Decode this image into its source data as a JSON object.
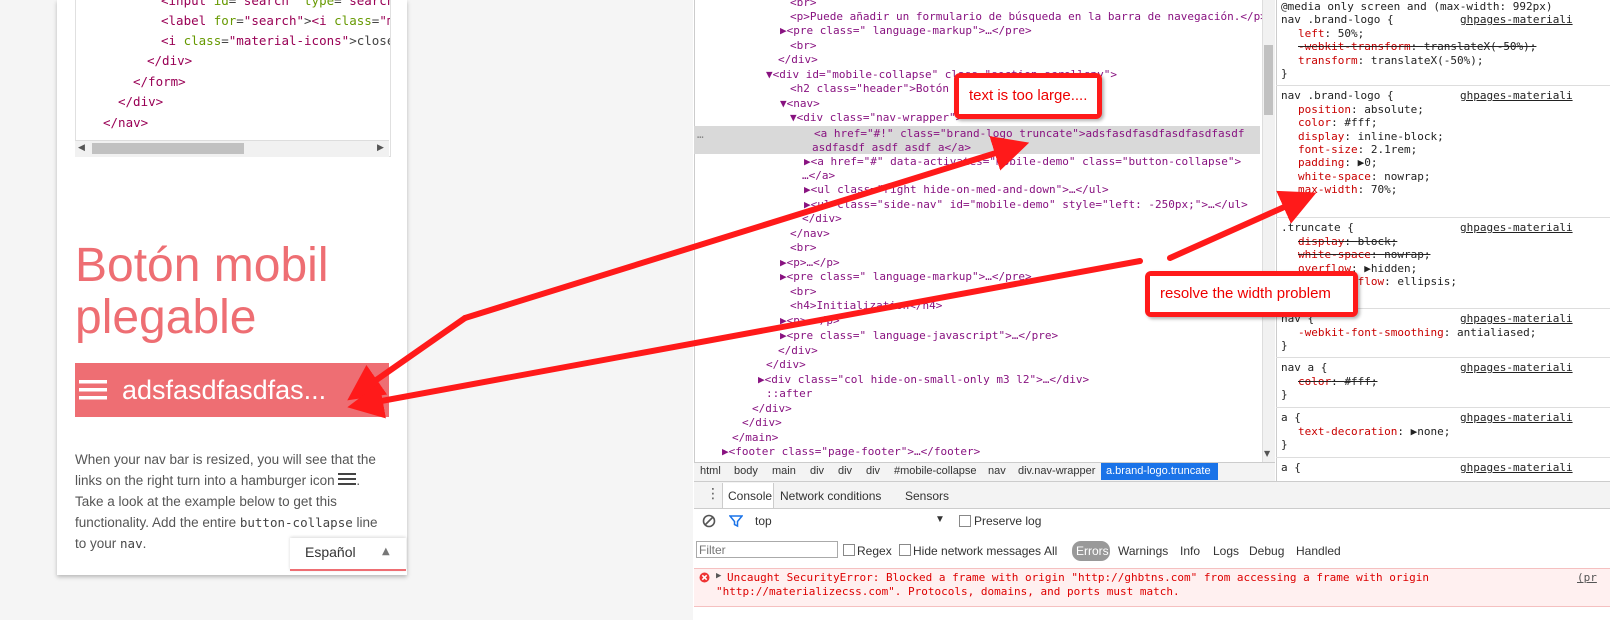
{
  "left_page": {
    "code_lines": [
      {
        "tag_open": "<input id=\"search\" type=\"search\"",
        "indent": 3
      },
      {
        "text": "<label for=\"search\"><i class=\"m",
        "indent": 3
      },
      {
        "text": "<i class=\"material-icons\">close</",
        "indent": 3
      },
      {
        "text": "</div>",
        "indent": 2
      },
      {
        "text": "</form>",
        "indent": 1
      },
      {
        "text": "</div>",
        "indent": 0
      },
      {
        "text": "</nav>",
        "indent": -1
      }
    ],
    "heading": "Botón mobil plegable",
    "brand_logo_text": "adsfasdfasdfas...",
    "paragraph_parts": {
      "p1": "When your nav bar is resized, you will see that the links on the right turn into a hamburger icon ",
      "p2": ". Take a look at the example below to get this functionality. Add the entire ",
      "code1": "button-collapse",
      "p3": " line to your ",
      "code2": "nav",
      "p4": "."
    },
    "language_selector": "Español"
  },
  "elements_panel": {
    "lines": [
      "<br>",
      "<p>Puede añadir un formulario de búsqueda en la barra de navegación.</p>",
      "▶<pre class=\" language-markup\">…</pre>",
      "<br>",
      "</div>",
      "▼<div id=\"mobile-collapse\" class=\"section scrollspy\">",
      "<h2 class=\"header\">Botón mobil plegable</h2>",
      "▼<nav>",
      "▼<div class=\"nav-wrapper\">",
      "<a href=\"#!\" class=\"brand-logo truncate\">adsfasdfasdfasdfasdfasdf",
      "asdfasdf asdf asdf a</a>",
      "▶<a href=\"#\" data-activates=\"mobile-demo\" class=\"button-collapse\">",
      "…</a>",
      "▶<ul class=\"right hide-on-med-and-down\">…</ul>",
      "▶<ul class=\"side-nav\" id=\"mobile-demo\" style=\"left: -250px;\">…</ul>",
      "</div>",
      "</nav>",
      "<br>",
      "▶<p>…</p>",
      "▶<pre class=\" language-markup\">…</pre>",
      "<br>",
      "<h4>Initialization</h4>",
      "▶<p>…</p>",
      "▶<pre class=\" language-javascript\">…</pre>",
      "</div>",
      "</div>",
      "▶<div class=\"col hide-on-small-only m3 l2\">…</div>",
      "::after",
      "</div>",
      "</div>",
      "</main>",
      "▶<footer class=\"page-footer\">…</footer>"
    ],
    "breadcrumb": [
      "html",
      "body",
      "main",
      "div",
      "div",
      "div",
      "#mobile-collapse",
      "nav",
      "div.nav-wrapper",
      "a.brand-logo.truncate"
    ]
  },
  "styles_panel": {
    "media_query": "@media only screen and (max-width: 992px)",
    "source": "ghpages-materiali",
    "rules": [
      {
        "selector": "nav .brand-logo {",
        "props": [
          {
            "name": "left",
            "value": "50%;",
            "struck": false
          },
          {
            "name": "-webkit-transform",
            "value": "translateX(-50%);",
            "struck": true
          },
          {
            "name": "transform",
            "value": "translateX(-50%);",
            "struck": false
          }
        ]
      },
      {
        "selector": "nav .brand-logo {",
        "props": [
          {
            "name": "position",
            "value": "absolute;",
            "struck": false
          },
          {
            "name": "color",
            "value": "#fff;",
            "struck": false
          },
          {
            "name": "display",
            "value": "inline-block;",
            "struck": false
          },
          {
            "name": "font-size",
            "value": "2.1rem;",
            "struck": false
          },
          {
            "name": "padding",
            "value": "▶0;",
            "struck": false
          },
          {
            "name": "white-space",
            "value": "nowrap;",
            "struck": false
          },
          {
            "name": "max-width",
            "value": "70%;",
            "struck": false
          }
        ]
      },
      {
        "selector": ".truncate {",
        "props": [
          {
            "name": "display",
            "value": "block;",
            "struck": true
          },
          {
            "name": "white-space",
            "value": "nowrap;",
            "struck": true
          },
          {
            "name": "overflow",
            "value": "▶hidden;",
            "struck": false
          },
          {
            "name": "text-overflow",
            "value": "ellipsis;",
            "struck": false
          }
        ]
      },
      {
        "selector": "nav {",
        "props": [
          {
            "name": "-webkit-font-smoothing",
            "value": "antialiased;",
            "struck": false
          }
        ]
      },
      {
        "selector": "nav a {",
        "props": [
          {
            "name": "color",
            "value": "#fff;",
            "struck": true
          }
        ]
      },
      {
        "selector": "a {",
        "props": [
          {
            "name": "text-decoration",
            "value": "▶none;",
            "struck": false
          }
        ]
      },
      {
        "selector": "a {",
        "props": []
      }
    ]
  },
  "console": {
    "tabs": [
      "Console",
      "Network conditions",
      "Sensors"
    ],
    "context": "top",
    "preserve_log": "Preserve log",
    "filter_placeholder": "Filter",
    "regex": "Regex",
    "hide_network": "Hide network messages",
    "levels": [
      "All",
      "Errors",
      "Warnings",
      "Info",
      "Logs",
      "Debug",
      "Handled"
    ],
    "error_line1": "Uncaught SecurityError: Blocked a frame with origin \"http://ghbtns.com\" from accessing a frame with origin",
    "error_line2": "\"http://materializecss.com\". Protocols, domains, and ports must match.",
    "error_source": "(pr"
  },
  "annotations": {
    "callout1": "text is too large....",
    "callout2": "resolve the width problem"
  },
  "colors": {
    "accent": "#ee6e73",
    "annotation_red": "#ff1a1a",
    "devtools_selected": "#1a73e8"
  }
}
